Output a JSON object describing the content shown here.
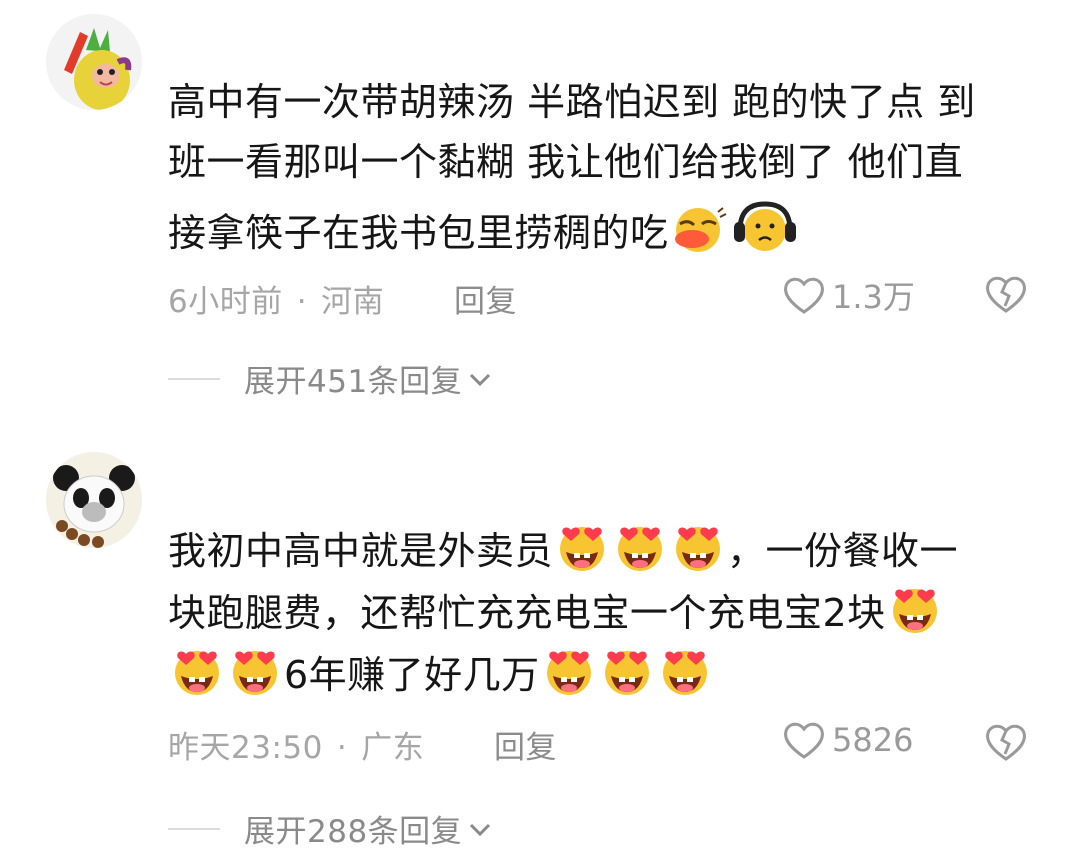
{
  "comments": [
    {
      "lines": [
        "高中有一次带胡辣汤 半路怕迟到 跑的快了点 到",
        "班一看那叫一个黏糊 我让他们给我倒了 他们直",
        "接拿筷子在我书包里捞稠的吃"
      ],
      "trailing_emojis": [
        "giggle-emoji",
        "headphones-emoji"
      ],
      "time": "6小时前",
      "location": "河南",
      "reply_label": "回复",
      "likes": "1.3万",
      "expand_label": "展开451条回复",
      "avatar_icon": "pineapple-character-avatar"
    },
    {
      "line1": "我初中高中就是外卖员",
      "line1_tail": "，一份餐收一",
      "line2": "块跑腿费，还帮忙充充电宝一个充电宝2块",
      "line3": "6年赚了好几万",
      "emoji_name": "heart-eyes-emoji",
      "time": "昨天23:50",
      "location": "广东",
      "reply_label": "回复",
      "likes": "5826",
      "expand_label": "展开288条回复",
      "avatar_icon": "panda-meme-avatar"
    }
  ],
  "colors": {
    "text": "#161616",
    "meta": "#a6a6a6",
    "divider": "#dcdcdc",
    "emoji_yellow": "#f7c531"
  }
}
